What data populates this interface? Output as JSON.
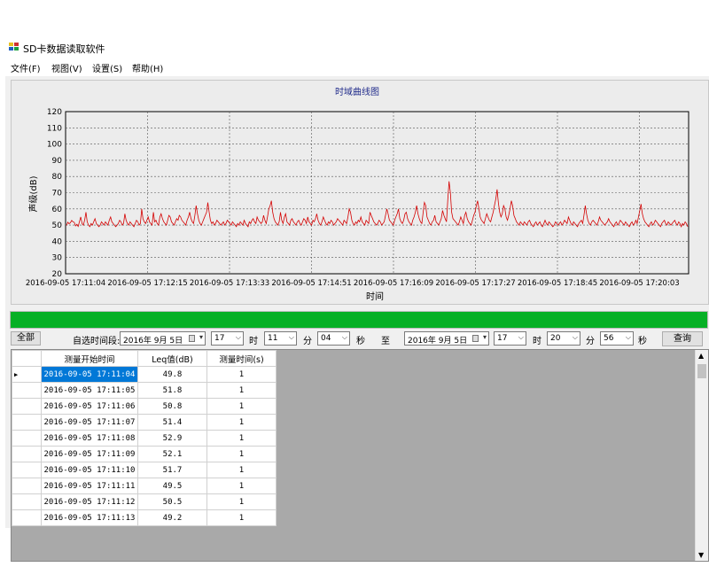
{
  "window": {
    "title": "SD卡数据读取软件"
  },
  "menu": [
    "文件(F)",
    "视图(V)",
    "设置(S)",
    "帮助(H)"
  ],
  "toolbar": {
    "all_label": "全部",
    "range_label": "自选时间段:",
    "hour_unit": "时",
    "minute_unit": "分",
    "second_unit": "秒",
    "to_label": "至",
    "query_label": "查询",
    "start": {
      "date": "2016年 9月 5日",
      "hour": "17",
      "minute": "11",
      "second": "04"
    },
    "end": {
      "date": "2016年 9月 5日",
      "hour": "17",
      "minute": "20",
      "second": "56"
    }
  },
  "progress": {
    "value": 1.0,
    "color": "#06b025"
  },
  "grid": {
    "columns": [
      "测量开始时间",
      "Leq值(dB)",
      "测量时间(s)"
    ],
    "rows": [
      [
        "2016-09-05 17:11:04",
        "49.8",
        "1"
      ],
      [
        "2016-09-05 17:11:05",
        "51.8",
        "1"
      ],
      [
        "2016-09-05 17:11:06",
        "50.8",
        "1"
      ],
      [
        "2016-09-05 17:11:07",
        "51.4",
        "1"
      ],
      [
        "2016-09-05 17:11:08",
        "52.9",
        "1"
      ],
      [
        "2016-09-05 17:11:09",
        "52.1",
        "1"
      ],
      [
        "2016-09-05 17:11:10",
        "51.7",
        "1"
      ],
      [
        "2016-09-05 17:11:11",
        "49.5",
        "1"
      ],
      [
        "2016-09-05 17:11:12",
        "50.5",
        "1"
      ],
      [
        "2016-09-05 17:11:13",
        "49.2",
        "1"
      ]
    ],
    "selected_row": 0,
    "selected_color": "#0078d7",
    "current_row_marker": "▶"
  },
  "chart_data": {
    "type": "line",
    "title": "时域曲线图",
    "xlabel": "时间",
    "ylabel": "声级(dB)",
    "ylim": [
      20,
      120
    ],
    "y_ticks": [
      20,
      30,
      40,
      50,
      60,
      70,
      80,
      90,
      100,
      110,
      120
    ],
    "x_ticks": [
      "2016-09-05 17:11:04",
      "2016-09-05 17:12:15",
      "2016-09-05 17:13:33",
      "2016-09-05 17:14:51",
      "2016-09-05 17:16:09",
      "2016-09-05 17:17:27",
      "2016-09-05 17:18:45",
      "2016-09-05 17:20:03"
    ],
    "grid": true,
    "line_color": "#d40000",
    "series": [
      {
        "values": [
          49.8,
          51.8,
          50.8,
          51.4,
          52.9,
          52.1,
          51.7,
          49.5,
          50.5,
          49.2,
          52,
          55,
          51,
          50,
          53,
          58,
          52,
          50,
          49,
          51,
          50,
          52,
          54,
          51,
          50,
          49,
          50,
          52,
          51,
          50,
          52,
          51,
          50,
          53,
          55,
          52,
          51,
          50,
          49,
          50,
          51,
          53,
          52,
          50,
          51,
          57,
          53,
          51,
          50,
          52,
          51,
          50,
          49,
          51,
          53,
          52,
          50,
          51,
          60,
          54,
          52,
          51,
          53,
          55,
          52,
          51,
          50,
          58,
          52,
          53,
          51,
          50,
          55,
          57,
          54,
          52,
          51,
          50,
          53,
          56,
          55,
          52,
          51,
          50,
          52,
          54,
          53,
          56,
          55,
          53,
          52,
          51,
          50,
          53,
          55,
          58,
          54,
          52,
          51,
          56,
          62,
          57,
          53,
          51,
          50,
          52,
          54,
          56,
          58,
          64,
          58,
          53,
          51,
          52,
          50,
          51,
          53,
          52,
          51,
          50,
          51,
          52,
          50,
          51,
          53,
          52,
          51,
          50,
          52,
          51,
          50,
          49,
          51,
          50,
          52,
          51,
          50,
          53,
          51,
          50,
          49,
          52,
          51,
          53,
          54,
          52,
          51,
          55,
          53,
          52,
          51,
          52,
          56,
          53,
          51,
          55,
          60,
          62,
          65,
          58,
          54,
          52,
          51,
          50,
          52,
          58,
          53,
          51,
          55,
          57,
          52,
          51,
          50,
          53,
          54,
          52,
          51,
          50,
          52,
          53,
          51,
          50,
          52,
          54,
          53,
          51,
          55,
          52,
          51,
          50,
          53,
          52,
          54,
          57,
          53,
          51,
          50,
          52,
          55,
          53,
          51,
          50,
          52,
          51,
          53,
          52,
          50,
          51,
          52,
          54,
          53,
          52,
          51,
          50,
          53,
          52,
          51,
          55,
          60,
          58,
          53,
          51,
          50,
          52,
          51,
          53,
          52,
          55,
          52,
          51,
          50,
          53,
          52,
          51,
          58,
          56,
          54,
          52,
          51,
          50,
          51,
          53,
          52,
          50,
          51,
          52,
          56,
          60,
          57,
          53,
          52,
          51,
          50,
          53,
          55,
          57,
          60,
          54,
          52,
          51,
          53,
          57,
          58,
          54,
          52,
          51,
          50,
          53,
          55,
          58,
          62,
          57,
          54,
          52,
          51,
          58,
          64,
          62,
          55,
          53,
          51,
          50,
          52,
          53,
          56,
          52,
          51,
          50,
          52,
          54,
          59,
          56,
          54,
          52,
          66,
          77,
          70,
          58,
          54,
          53,
          52,
          51,
          50,
          52,
          55,
          53,
          51,
          56,
          58,
          54,
          52,
          51,
          50,
          53,
          56,
          58,
          62,
          65,
          60,
          55,
          53,
          52,
          51,
          54,
          57,
          55,
          53,
          52,
          55,
          58,
          62,
          66,
          72,
          64,
          58,
          55,
          57,
          62,
          60,
          55,
          53,
          56,
          60,
          65,
          62,
          56,
          54,
          52,
          51,
          50,
          52,
          51,
          50,
          52,
          51,
          50,
          52,
          53,
          51,
          50,
          49,
          51,
          52,
          50,
          51,
          52,
          50,
          49,
          51,
          53,
          51,
          50,
          52,
          51,
          50,
          49,
          50,
          52,
          51,
          50,
          51,
          52,
          50,
          51,
          53,
          52,
          51,
          55,
          53,
          51,
          50,
          52,
          51,
          50,
          49,
          51,
          52,
          53,
          51,
          56,
          62,
          57,
          53,
          51,
          50,
          52,
          53,
          52,
          51,
          50,
          52,
          55,
          53,
          52,
          51,
          50,
          51,
          52,
          54,
          52,
          51,
          50,
          49,
          51,
          52,
          50,
          51,
          53,
          52,
          51,
          50,
          52,
          51,
          50,
          49,
          51,
          52,
          50,
          51,
          53,
          51,
          55,
          59,
          63,
          57,
          54,
          52,
          51,
          50,
          49,
          51,
          52,
          50,
          51,
          53,
          52,
          51,
          50,
          49,
          51,
          52,
          53,
          51,
          50,
          52,
          51,
          50,
          51,
          52,
          53,
          51,
          50,
          52,
          51,
          49,
          51,
          50,
          52,
          51,
          49
        ]
      }
    ]
  }
}
